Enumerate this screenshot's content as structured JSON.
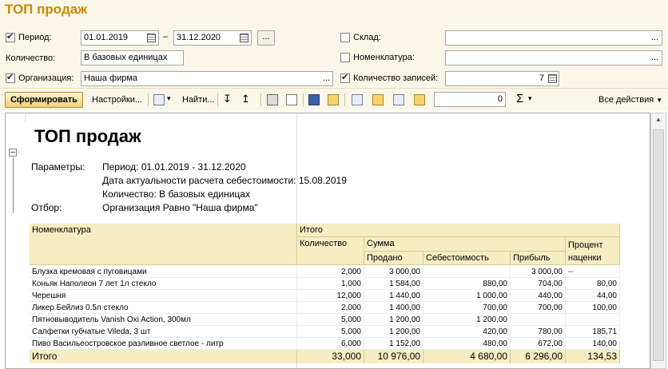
{
  "window": {
    "title": "ТОП продаж"
  },
  "form": {
    "period_label": "Период:",
    "period_from": "01.01.2019",
    "period_dash": "–",
    "period_to": "31.12.2020",
    "ellipsis": "...",
    "quantity_label": "Количество:",
    "quantity_value": "В базовых единицах",
    "org_label": "Организация:",
    "org_value": "Наша фирма",
    "warehouse_label": "Склад:",
    "warehouse_value": "",
    "nomenclature_label": "Номенклатура:",
    "nomenclature_value": "",
    "records_label": "Количество записей:",
    "records_value": "7"
  },
  "toolbar": {
    "generate": "Сформировать",
    "settings": "Настройки...",
    "find": "Найти...",
    "counter": "0",
    "sigma": "Σ",
    "all_actions": "Все действия"
  },
  "report": {
    "title": "ТОП продаж",
    "params_label": "Параметры:",
    "params_lines": [
      "Период: 01.01.2019 - 31.12.2020",
      "Дата актуальности расчета себестоимости: 15.08.2019",
      "Количество: В базовых единицах"
    ],
    "filter_label": "Отбор:",
    "filter_value": "Организация Равно \"Наша фирма\"",
    "headers": {
      "nomenclature": "Номенклатура",
      "total": "Итого",
      "quantity": "Количество",
      "sum": "Сумма",
      "sold": "Продано",
      "cost": "Себестоимость",
      "profit": "Прибыль",
      "markup": "Процент наценки"
    },
    "rows": [
      {
        "name": "Блузка кремовая с пуговицами",
        "qty": "2,000",
        "sold": "3 000,00",
        "cost": "",
        "profit": "3 000,00",
        "markup": "--"
      },
      {
        "name": "Коньяк Наполеон 7 лет 1л стекло",
        "qty": "1,000",
        "sold": "1 584,00",
        "cost": "880,00",
        "profit": "704,00",
        "markup": "80,00"
      },
      {
        "name": "Черешня",
        "qty": "12,000",
        "sold": "1 440,00",
        "cost": "1 000,00",
        "profit": "440,00",
        "markup": "44,00"
      },
      {
        "name": "Ликер Бейлиз 0.5л стекло",
        "qty": "2,000",
        "sold": "1 400,00",
        "cost": "700,00",
        "profit": "700,00",
        "markup": "100,00"
      },
      {
        "name": "Пятновыводитель Vanish Oxi Action, 300мл",
        "qty": "5,000",
        "sold": "1 200,00",
        "cost": "1 200,00",
        "profit": "",
        "markup": ""
      },
      {
        "name": "Салфетки губчатые Vileda, 3 шт",
        "qty": "5,000",
        "sold": "1 200,00",
        "cost": "420,00",
        "profit": "780,00",
        "markup": "185,71"
      },
      {
        "name": "Пиво Васильеостровское разливное светлое - литр",
        "qty": "6,000",
        "sold": "1 152,00",
        "cost": "480,00",
        "profit": "672,00",
        "markup": "140,00"
      }
    ],
    "total_row": {
      "name": "Итого",
      "qty": "33,000",
      "sold": "10 976,00",
      "cost": "4 680,00",
      "profit": "6 296,00",
      "markup": "134,53"
    }
  }
}
